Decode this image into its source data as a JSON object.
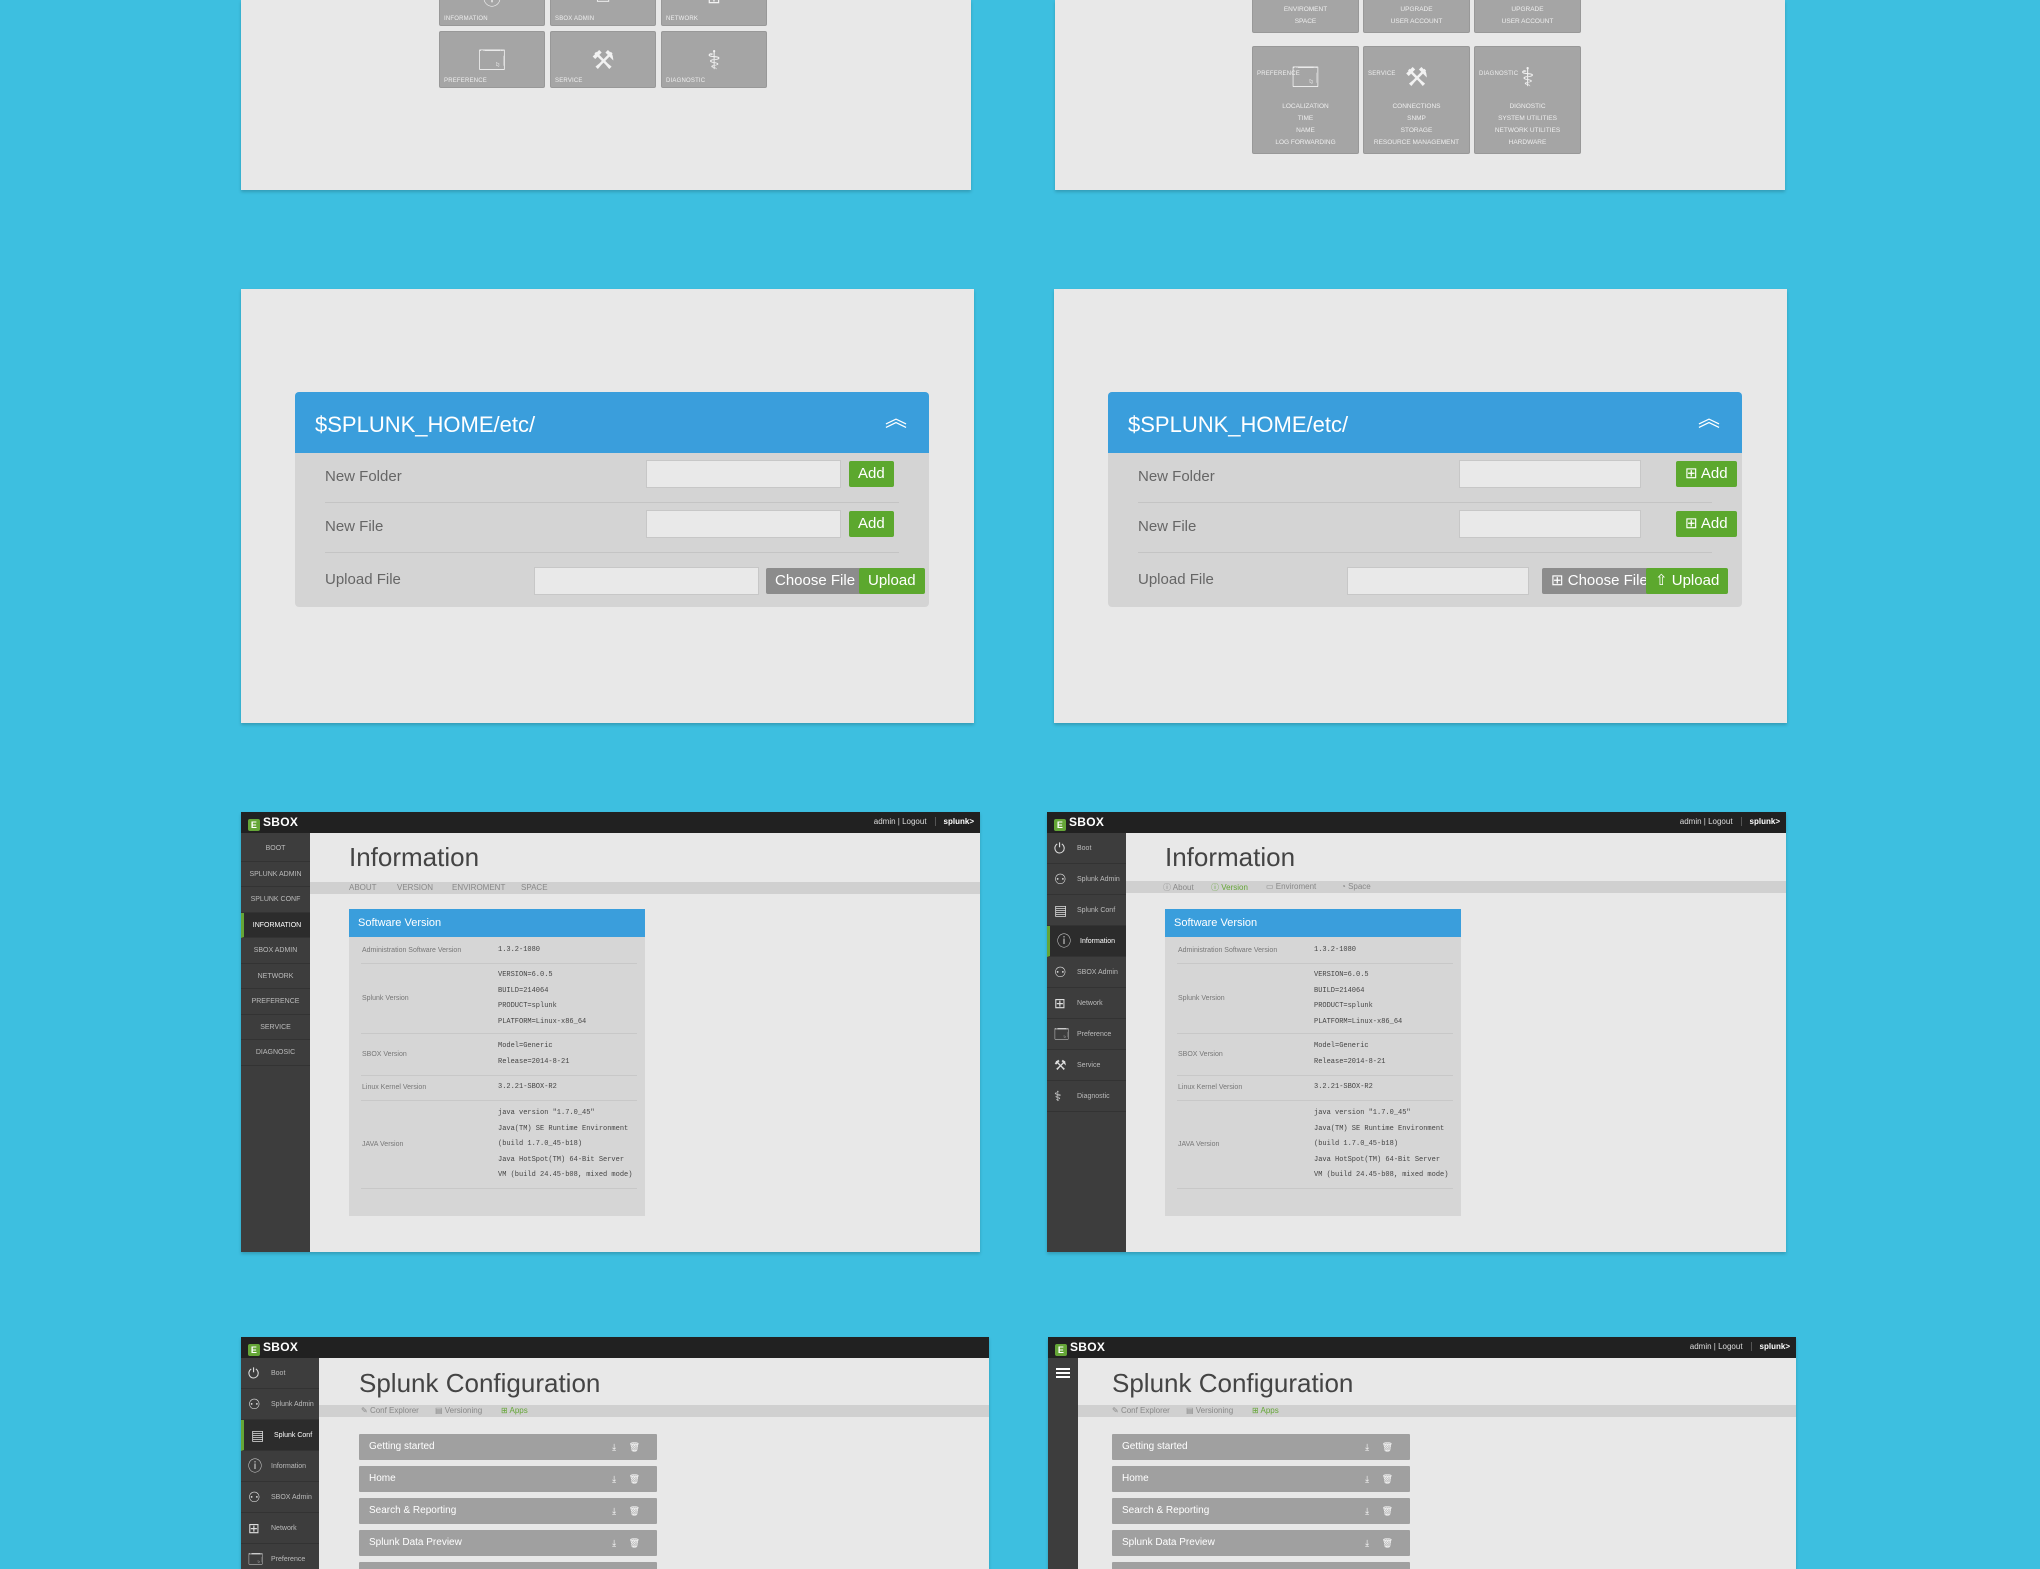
{
  "tile_screen_basic": {
    "top_tiles": [
      "INFORMATION",
      "SBOX ADMIN",
      "NETWORK"
    ],
    "tiles": [
      {
        "label": "PREFERENCE",
        "icon": "window-chart-icon"
      },
      {
        "label": "SERVICE",
        "icon": "tools-icon"
      },
      {
        "label": "DIAGNOSTIC",
        "icon": "stethoscope-icon"
      }
    ]
  },
  "tile_screen_detailed": {
    "top_tiles": [
      {
        "sub": [
          "ENVIROMENT",
          "SPACE"
        ]
      },
      {
        "sub": [
          "UPGRADE",
          "USER ACCOUNT"
        ]
      },
      {
        "sub": [
          "UPGRADE",
          "USER ACCOUNT"
        ]
      }
    ],
    "tiles": [
      {
        "label": "PREFERENCE",
        "sub": [
          "LOCALIZATION",
          "TIME",
          "NAME",
          "LOG FORWARDING"
        ]
      },
      {
        "label": "SERVICE",
        "sub": [
          "CONNECTIONS",
          "SNMP",
          "STORAGE",
          "RESOURCE MANAGEMENT"
        ]
      },
      {
        "label": "DIAGNOSTIC",
        "sub": [
          "DIGNOSTIC",
          "SYSTEM UTILITIES",
          "NETWORK UTILITIES",
          "HARDWARE"
        ]
      }
    ]
  },
  "file_panel": {
    "title": "$SPLUNK_HOME/etc/",
    "new_folder_label": "New Folder",
    "new_file_label": "New File",
    "upload_file_label": "Upload File",
    "add_label": "Add",
    "choose_label": "Choose File",
    "upload_label": "Upload"
  },
  "app": {
    "brand": "SBOX",
    "brand_letter": "E",
    "user": "admin",
    "logout": "Logout",
    "splunk": "splunk>"
  },
  "info_screen": {
    "title": "Information",
    "tabs_caps": [
      "ABOUT",
      "VERSION",
      "ENVIROMENT",
      "SPACE"
    ],
    "tabs": [
      "About",
      "Version",
      "Enviroment",
      "Space"
    ],
    "sidebar_caps": [
      "BOOT",
      "SPLUNK ADMIN",
      "SPLUNK CONF",
      "INFORMATION",
      "SBOX ADMIN",
      "NETWORK",
      "PREFERENCE",
      "SERVICE",
      "DIAGNOSIC"
    ],
    "sidebar": [
      "Boot",
      "Splunk Admin",
      "Splunk Conf",
      "Information",
      "SBOX Admin",
      "Network",
      "Preference",
      "Service",
      "Diagnostic"
    ],
    "panel_title": "Software Version",
    "rows": [
      {
        "key": "Administration Software Version",
        "value": "1.3.2-1080"
      },
      {
        "key": "Splunk Version",
        "value": "VERSION=6.0.5\nBUILD=214064\nPRODUCT=splunk\nPLATFORM=Linux-x86_64"
      },
      {
        "key": "SBOX Version",
        "value": "Model=Generic\nRelease=2014-8-21"
      },
      {
        "key": "Linux Kernel Version",
        "value": "3.2.21-SBOX-R2"
      },
      {
        "key": "JAVA Version",
        "value": "java version \"1.7.0_45\"\nJava(TM) SE Runtime Environment\n(build 1.7.0_45-b18)\nJava HotSpot(TM) 64-Bit Server\nVM (build 24.45-b08, mixed mode)"
      }
    ]
  },
  "conf_screen": {
    "title": "Splunk Configuration",
    "tabs": [
      "Conf Explorer",
      "Versioning",
      "Apps"
    ],
    "sidebar": [
      "Boot",
      "Splunk Admin",
      "Splunk Conf",
      "Information",
      "SBOX Admin",
      "Network",
      "Preference"
    ],
    "apps": [
      "Getting started",
      "Home",
      "Search & Reporting",
      "Splunk Data Preview"
    ],
    "row_actions": "⤓ 🗑"
  },
  "colors": {
    "background": "#3dbfe0",
    "panel_blue": "#3a9edc",
    "green": "#5ca82e",
    "accent_green": "#65a637"
  }
}
